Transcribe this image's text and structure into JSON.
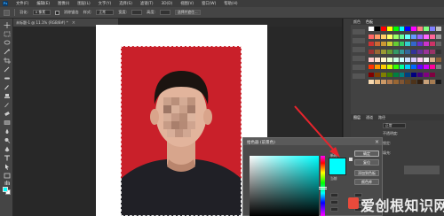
{
  "menubar": {
    "logo": "Ps",
    "items": [
      "文件(F)",
      "编辑(E)",
      "图像(I)",
      "图层(L)",
      "文字(Y)",
      "选择(S)",
      "滤镜(T)",
      "3D(D)",
      "视图(V)",
      "窗口(W)",
      "帮助(H)"
    ]
  },
  "options": {
    "feather_label": "羽化:",
    "feather_value": "0 像素",
    "antialias_label": "消除锯齿",
    "style_label": "样式:",
    "style_value": "正常",
    "width_label": "宽度:",
    "height_label": "高度:",
    "select_mask_label": "选择并遮住..."
  },
  "document": {
    "tab_title": "未标题-1 @ 11.1% (RGB/8#) *",
    "close": "×"
  },
  "panels": {
    "tabs": [
      "颜色",
      "色板"
    ],
    "layers_tabs": [
      "图层",
      "通道",
      "路径"
    ],
    "blend_mode": "正常",
    "opacity_label": "不透明度:",
    "lock_label": "锁定:",
    "fill_label": "填充:"
  },
  "swatch_colors": [
    "#ffffff",
    "#000000",
    "#ff0000",
    "#ffff00",
    "#00ff00",
    "#00ffff",
    "#0000ff",
    "#ff00ff",
    "#ff8080",
    "#80ff80",
    "#8080ff",
    "#c0c0c0",
    "#ff6666",
    "#ff9966",
    "#ffcc66",
    "#ffff66",
    "#99ff66",
    "#66ff99",
    "#66ffff",
    "#6699ff",
    "#9966ff",
    "#ff66ff",
    "#ff6699",
    "#999999",
    "#cc3333",
    "#cc6633",
    "#cc9933",
    "#cccc33",
    "#66cc33",
    "#33cc66",
    "#33cccc",
    "#3366cc",
    "#6633cc",
    "#cc33cc",
    "#cc3366",
    "#666666",
    "#993333",
    "#996633",
    "#999933",
    "#669933",
    "#339966",
    "#339999",
    "#336699",
    "#333399",
    "#663399",
    "#993399",
    "#993366",
    "#333333",
    "#ffcccc",
    "#ffe0cc",
    "#fff5cc",
    "#e6ffcc",
    "#ccffe6",
    "#ccffff",
    "#cce0ff",
    "#d9ccff",
    "#ffccf2",
    "#f2f2f2",
    "#d9b38c",
    "#8c6239",
    "#ff3300",
    "#ff9900",
    "#ffcc00",
    "#ccff00",
    "#33ff00",
    "#00ff99",
    "#00ccff",
    "#0066ff",
    "#6600ff",
    "#cc00ff",
    "#ff0099",
    "#808080",
    "#800000",
    "#804000",
    "#808000",
    "#408000",
    "#008040",
    "#008080",
    "#004080",
    "#000080",
    "#400080",
    "#800080",
    "#800040",
    "#404040",
    "#f7d9b0",
    "#e6b880",
    "#cc9966",
    "#b37a4d",
    "#996633",
    "#805533",
    "#664422",
    "#4d331a",
    "#331f0f",
    "#c9a27a",
    "#a67c52",
    "#1a1a1a"
  ],
  "dialog": {
    "title": "拾色器 (前景色)",
    "close": "×",
    "new_label": "新的",
    "current_label": "当前",
    "ok": "确定",
    "reset": "复位",
    "add_to_swatches": "添加到色板",
    "color_libraries": "颜色库",
    "picked_color": "#00ffff"
  },
  "watermark": {
    "text": "爱创根知识网"
  },
  "colors": {
    "annotation_arrow": "#e8242c",
    "foreground": "#00ffff",
    "background_layer": "#c9202a"
  }
}
